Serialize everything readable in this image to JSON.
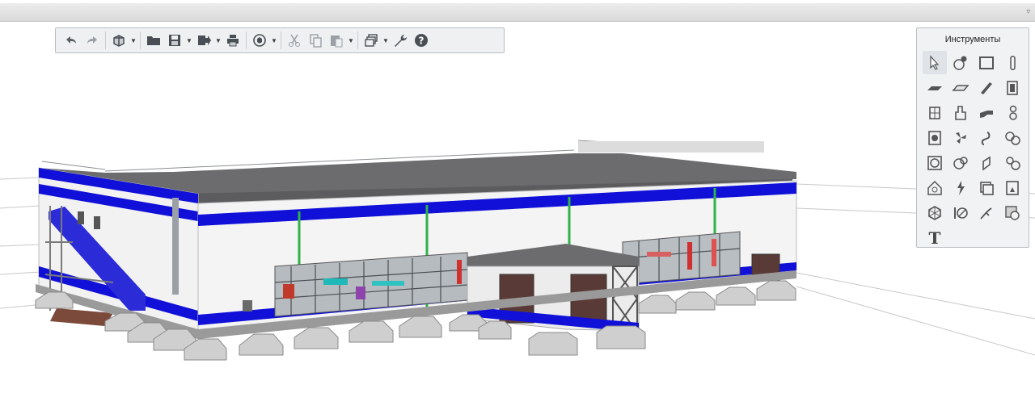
{
  "window": {
    "menu_arrow": "▿"
  },
  "toolbar": {
    "items": [
      "undo-icon",
      "redo-icon",
      "view-3d-icon",
      "open-folder-icon",
      "save-icon",
      "export-icon",
      "print-icon",
      "rotate-view-icon",
      "cut-icon",
      "copy-icon",
      "paste-icon",
      "layers-icon",
      "settings-wrench-icon",
      "help-icon"
    ]
  },
  "tools_panel": {
    "title": "Инструменты",
    "tools": [
      "select-arrow-icon",
      "object-model-icon",
      "wall-icon",
      "column-icon",
      "slab-icon",
      "floor-icon",
      "beam-icon",
      "door-icon",
      "window-icon",
      "equipment-icon",
      "pipe-icon",
      "pipe-fitting-icon",
      "tank-icon",
      "fan-icon",
      "valve-icon",
      "pump-icon",
      "gauge-icon",
      "duct-fitting-icon",
      "duct-icon",
      "accessory-icon",
      "lamp-icon",
      "electrical-icon",
      "panel-icon",
      "cabinet-icon",
      "network-icon",
      "sensor-icon",
      "cable-icon",
      "hatch-icon",
      "text-icon"
    ],
    "text_tool_label": "T"
  },
  "colors": {
    "blue_stripe": "#1010d8",
    "roof": "#6d6d70",
    "door": "#5a3a36"
  }
}
